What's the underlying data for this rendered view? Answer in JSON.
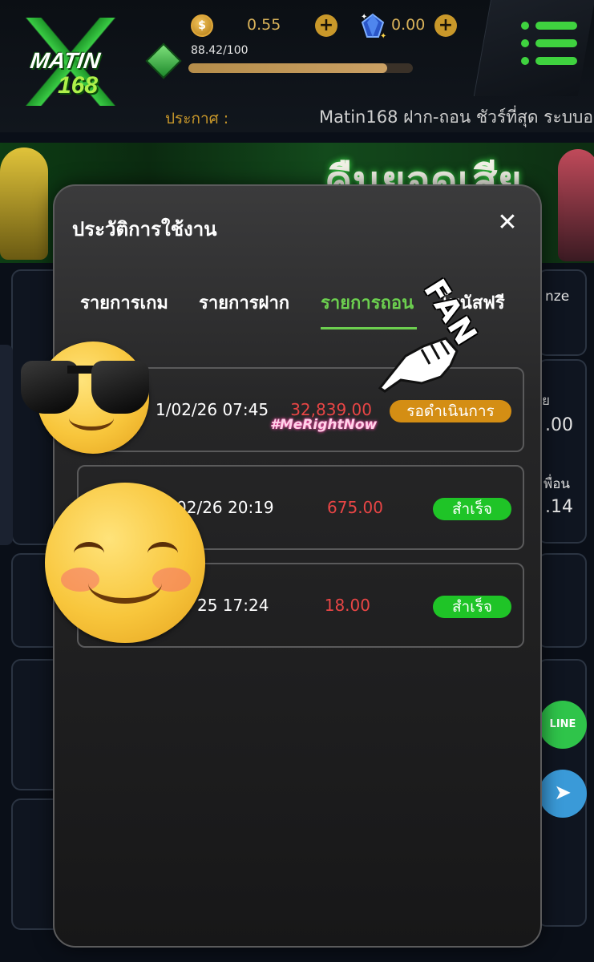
{
  "header": {
    "logo_text": "MATIN",
    "logo_number": "168",
    "coin_symbol": "$",
    "coins": "0.55",
    "gems": "0.00",
    "exp": "88.42/100",
    "exp_progress": 0.8842,
    "announcement_label": "ประกาศ :",
    "announcement_text": "Matin168 ฝาก-ถอน ชัวร์ที่สุด ระบบอ"
  },
  "banner": {
    "title": "คืนยอดเสีย"
  },
  "background": {
    "partial_labels": [
      "nze",
      "ย",
      ".00",
      "พื่อน",
      ".14"
    ]
  },
  "social": {
    "line_label": "LINE",
    "telegram_glyph": "➤"
  },
  "modal": {
    "title": "ประวัติการใช้งาน",
    "close_glyph": "✕",
    "tabs": [
      {
        "label": "รายการเกม",
        "active": false
      },
      {
        "label": "รายการฝาก",
        "active": false
      },
      {
        "label": "รายการถอน",
        "active": true
      },
      {
        "label": "โบนัสฟรี",
        "active": false
      }
    ],
    "transactions": [
      {
        "date": "1/02/26 07:45",
        "amount": "32,839.00",
        "status": "รอดำเนินการ",
        "status_type": "pending"
      },
      {
        "date": "02/26 20:19",
        "amount": "675.00",
        "status": "สำเร็จ",
        "status_type": "success"
      },
      {
        "date": "25 17:24",
        "amount": "18.00",
        "status": "สำเร็จ",
        "status_type": "success"
      }
    ]
  },
  "stickers": {
    "fan": "FAN",
    "hashtag": "#MeRightNow"
  },
  "colors": {
    "accent_green": "#6ccf4f",
    "pending": "#d48e14",
    "success": "#1fc427",
    "amount_red": "#e84545",
    "gold": "#c9982a"
  }
}
